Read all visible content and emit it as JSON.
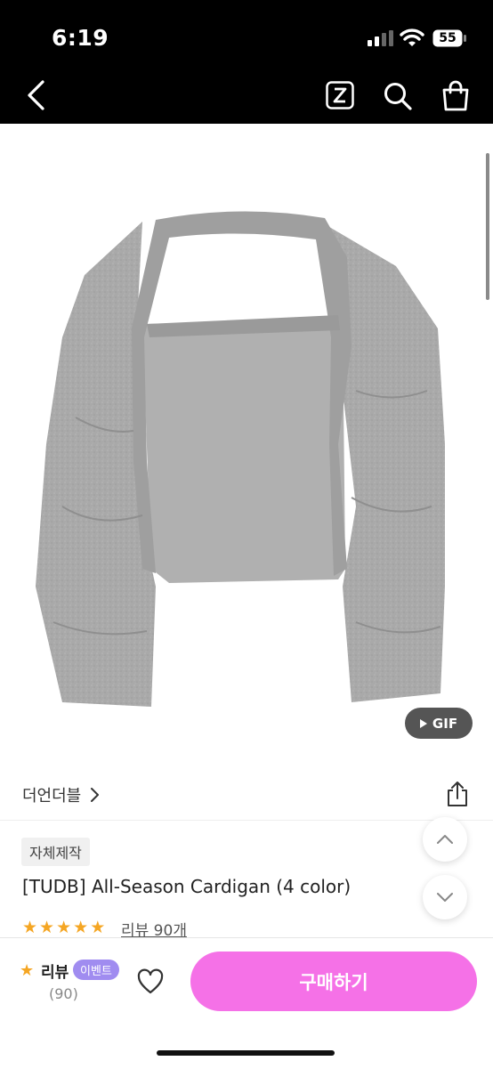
{
  "status_bar": {
    "time": "6:19",
    "battery": "55"
  },
  "header": {
    "icons": [
      "chevron-left-icon",
      "z-icon",
      "search-icon",
      "shopping-bag-icon"
    ]
  },
  "product_image": {
    "gif_label": "GIF"
  },
  "product": {
    "brand": "더언더블",
    "tag": "자체제작",
    "title": "[TUDB] All-Season Cardigan (4 color)",
    "rating_stars": 5,
    "review_link": "리뷰 90개"
  },
  "bottom_bar": {
    "review_label": "리뷰",
    "event_badge": "이벤트",
    "review_count": "(90)",
    "buy_label": "구매하기"
  },
  "colors": {
    "accent_pink": "#f571e7",
    "badge_purple": "#a08cf0",
    "star": "#f5a623"
  }
}
